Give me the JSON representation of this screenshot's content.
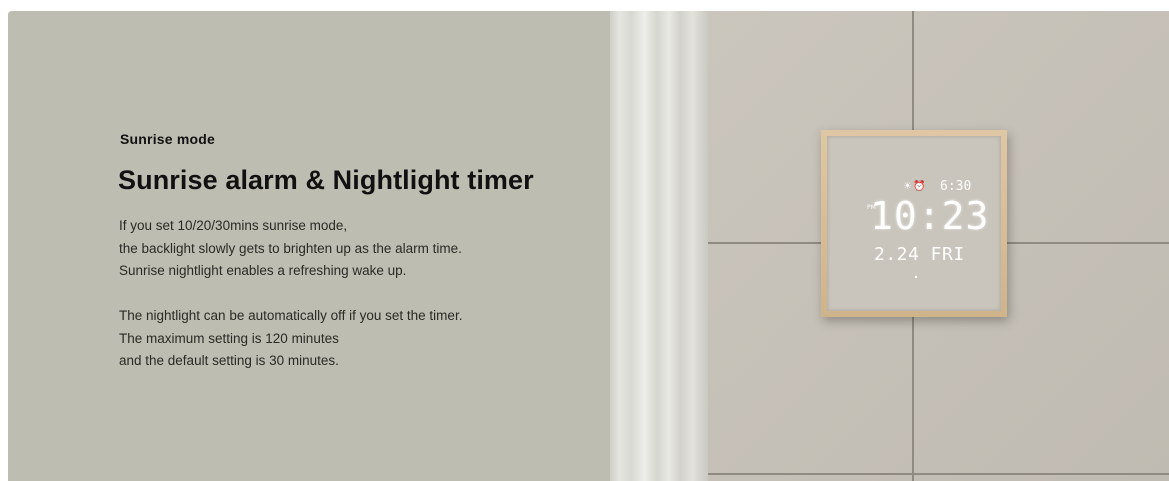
{
  "section": {
    "eyebrow": "Sunrise mode",
    "headline": "Sunrise alarm & Nightlight timer",
    "paragraph1": [
      "If you set 10/20/30mins sunrise mode,",
      "the backlight slowly gets to brighten up as the alarm time.",
      "Sunrise nightlight enables a refreshing wake up."
    ],
    "paragraph2": [
      "The nightlight can be automatically off if you set the timer.",
      "The maximum setting is 120 minutes",
      "and the default setting is 30 minutes."
    ]
  },
  "clock": {
    "icons": "☀⏰",
    "alarm_time": "6:30",
    "pm_indicator": "PM",
    "time": "10:23",
    "date": "2.24 FRI"
  },
  "colors": {
    "panel_background": "#bebdb1",
    "text": "#111111",
    "clock_frame": "#d9bf99",
    "clock_digits": "#ffffff"
  }
}
